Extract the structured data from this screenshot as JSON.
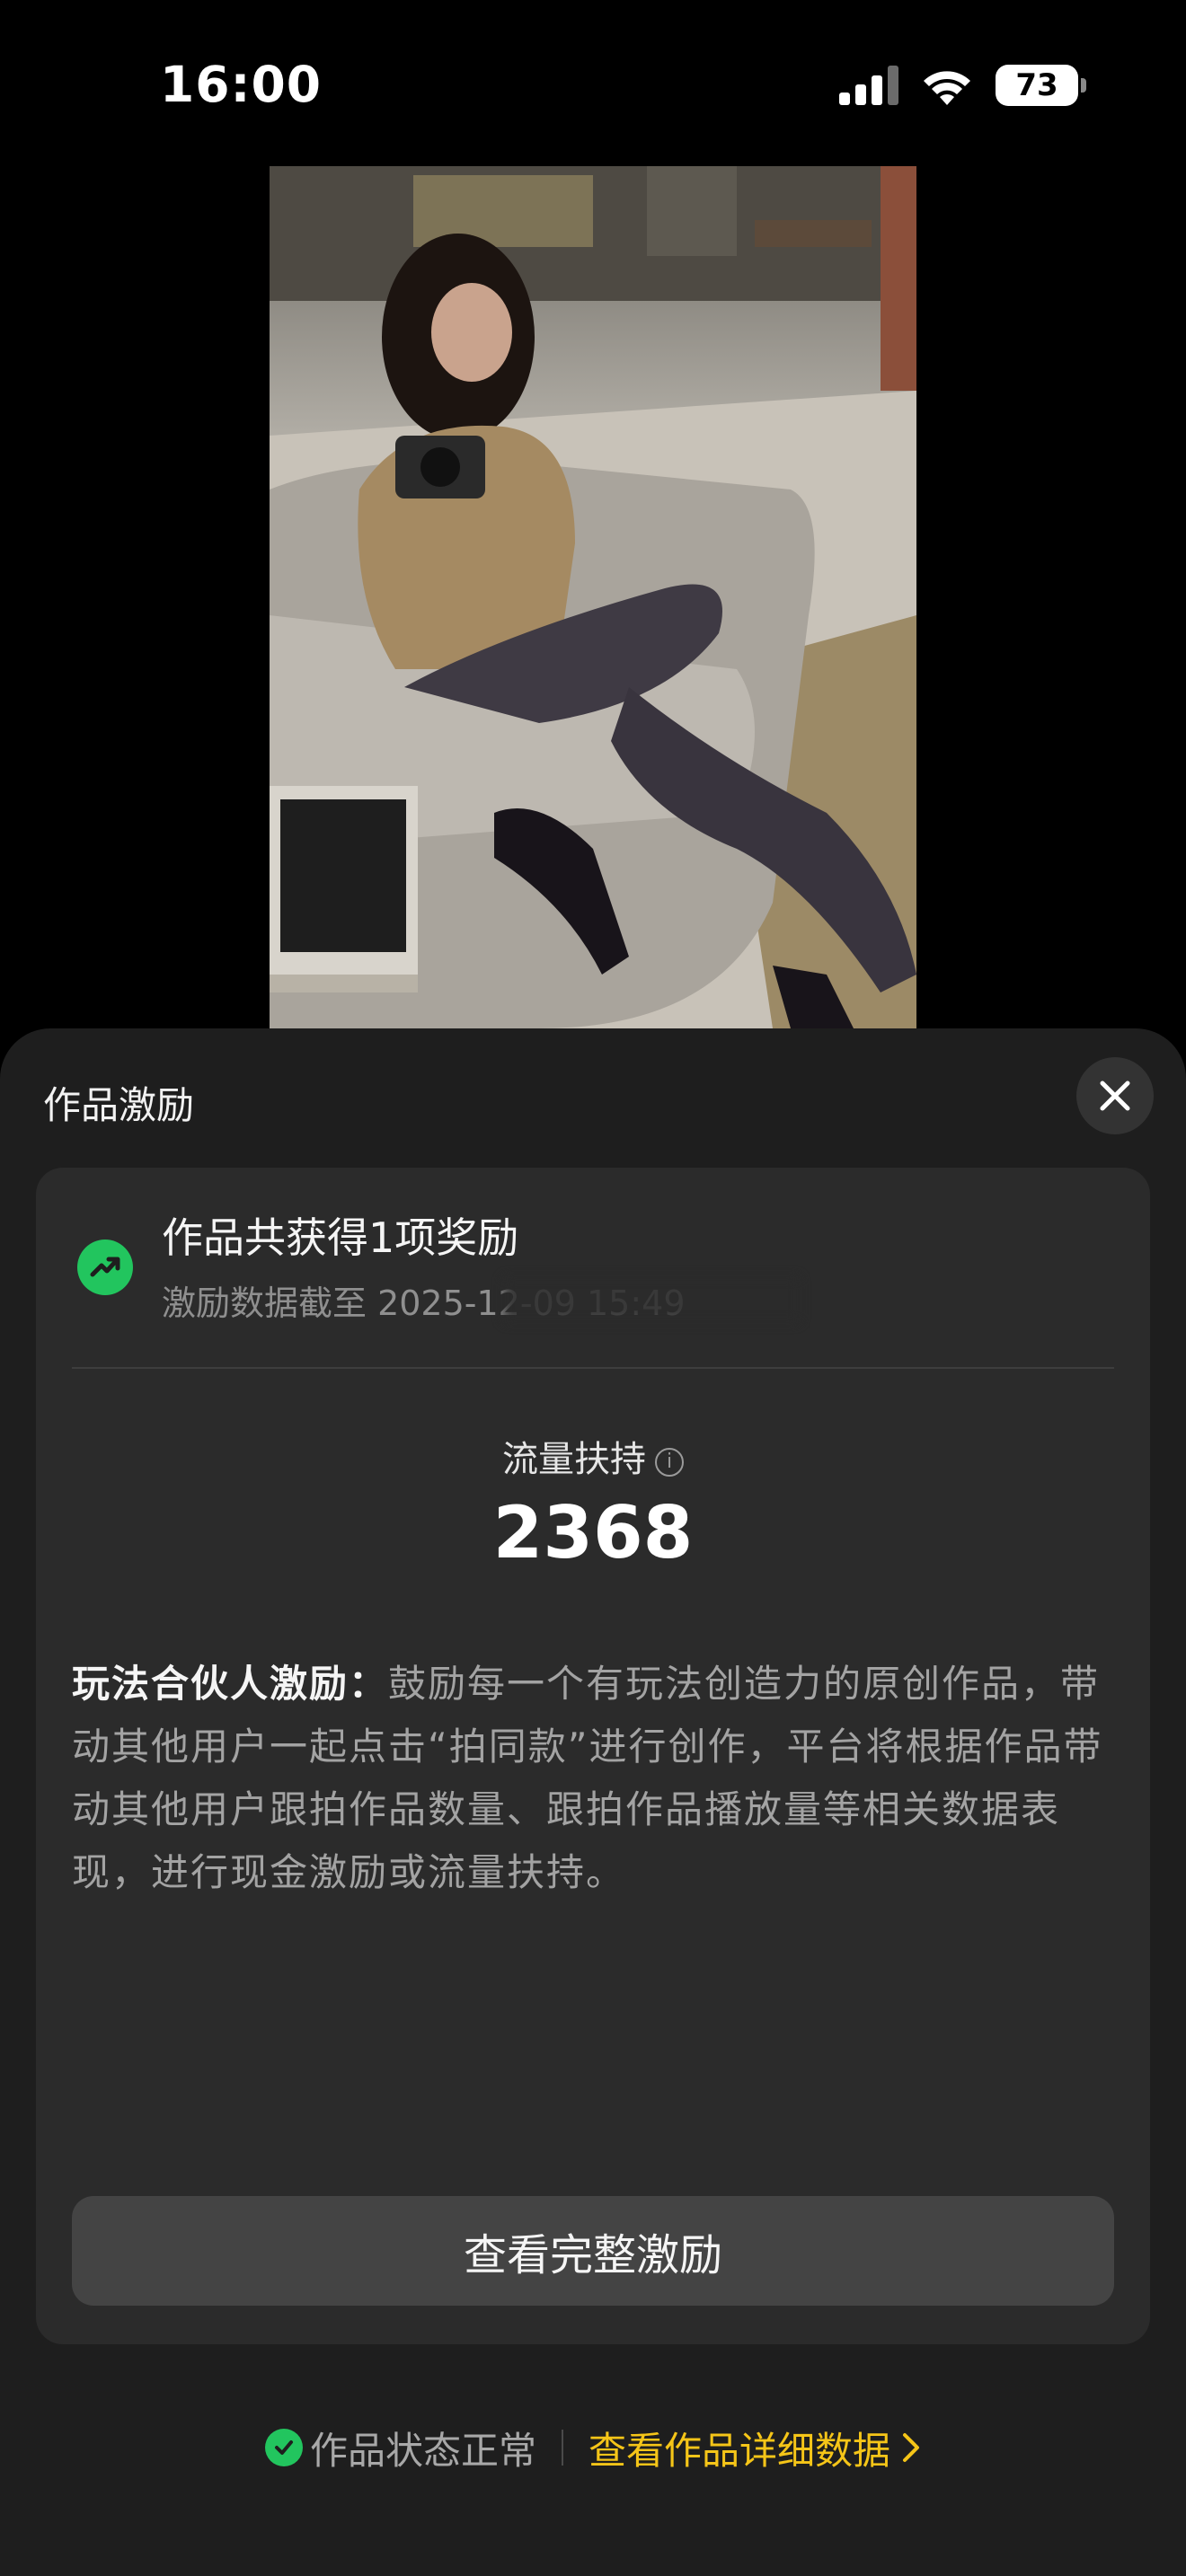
{
  "status_bar": {
    "time": "16:00",
    "battery": "73"
  },
  "sheet": {
    "title": "作品激励",
    "close_icon": "close-icon"
  },
  "card": {
    "award_title": "作品共获得1项奖励",
    "award_subtitle": "激励数据截至 2025-12-09 15:49",
    "metric_label": "流量扶持",
    "metric_value": "2368",
    "description_lead": "玩法合伙人激励：",
    "description_body": "鼓励每一个有玩法创造力的原创作品，带动其他用户一起点击“拍同款”进行创作，平台将根据作品带动其他用户跟拍作品数量、跟拍作品播放量等相关数据表现，进行现金激励或流量扶持。",
    "button_label": "查看完整激励"
  },
  "footer": {
    "status_text": "作品状态正常",
    "detail_link": "查看作品详细数据"
  },
  "colors": {
    "accent_green": "#22c55e",
    "link_yellow": "#f5c518",
    "sheet_bg": "#1e1e1e",
    "card_bg": "#2b2b2b"
  }
}
